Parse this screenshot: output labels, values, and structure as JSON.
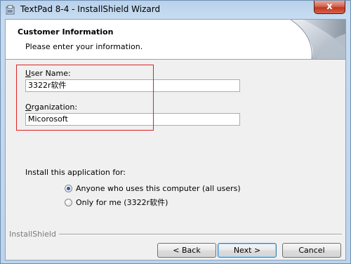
{
  "window": {
    "title": "TextPad 8-4 - InstallShield Wizard",
    "close_label": "x"
  },
  "header": {
    "title": "Customer Information",
    "subtitle": "Please enter your information."
  },
  "form": {
    "user_name": {
      "label_accel": "U",
      "label_rest": "ser Name:",
      "value": "3322r软件"
    },
    "organization": {
      "label_accel": "O",
      "label_rest": "rganization:",
      "value": "Micorosoft"
    }
  },
  "install_for": {
    "label": "Install this application for:",
    "options": [
      {
        "label": "Anyone who uses this computer (all users)",
        "selected": true
      },
      {
        "label": "Only for me (3322r软件)",
        "selected": false
      }
    ]
  },
  "footer": {
    "brand": "InstallShield",
    "back_label": "< Back",
    "next_label": "Next >",
    "cancel_label": "Cancel"
  },
  "colors": {
    "highlight": "#e02020",
    "close_button": "#c0391f",
    "radio_dot": "#2a5aa8"
  },
  "icons": {
    "app": "installer-icon",
    "header_art": "page-curl-art"
  }
}
